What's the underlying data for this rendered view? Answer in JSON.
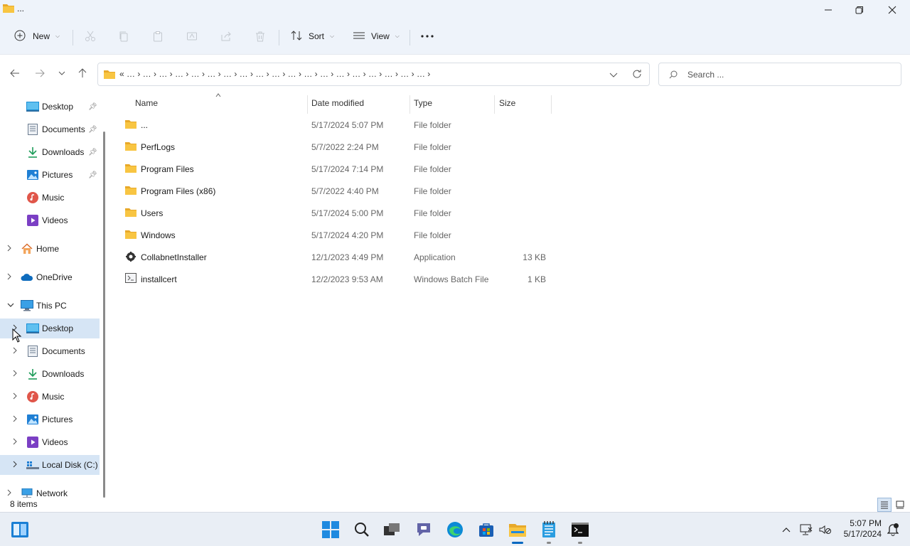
{
  "window": {
    "title": "..."
  },
  "commandbar": {
    "new_label": "New",
    "sort_label": "Sort",
    "view_label": "View",
    "more_label": "···"
  },
  "address": {
    "crumbs": "«  …  ›  …  ›  …  ›  …  ›  …  ›  …  ›  …  ›  …  ›  …  ›  …  ›  …  ›  …  ›  …  ›  …  ›  …  ›  …  ›  …  ›  …  ›  …  ›"
  },
  "search": {
    "placeholder": "Search ..."
  },
  "nav": {
    "quick": [
      {
        "label": "Desktop",
        "icon": "desktop-icon"
      },
      {
        "label": "Documents",
        "icon": "documents-icon"
      },
      {
        "label": "Downloads",
        "icon": "downloads-icon"
      },
      {
        "label": "Pictures",
        "icon": "pictures-icon"
      },
      {
        "label": "Music",
        "icon": "music-icon"
      },
      {
        "label": "Videos",
        "icon": "videos-icon"
      }
    ],
    "home": "Home",
    "onedrive": "OneDrive",
    "thispc": "This PC",
    "pc_items": [
      {
        "label": "Desktop",
        "icon": "desktop-icon"
      },
      {
        "label": "Documents",
        "icon": "documents-icon"
      },
      {
        "label": "Downloads",
        "icon": "downloads-icon"
      },
      {
        "label": "Music",
        "icon": "music-icon"
      },
      {
        "label": "Pictures",
        "icon": "pictures-icon"
      },
      {
        "label": "Videos",
        "icon": "videos-icon"
      },
      {
        "label": "Local Disk (C:)",
        "icon": "drive-icon"
      }
    ],
    "network": "Network"
  },
  "columns": {
    "name": "Name",
    "date": "Date modified",
    "type": "Type",
    "size": "Size"
  },
  "files": [
    {
      "name": "...",
      "date": "5/17/2024 5:07 PM",
      "type": "File folder",
      "size": "",
      "icon": "folder-icon"
    },
    {
      "name": "PerfLogs",
      "date": "5/7/2022 2:24 PM",
      "type": "File folder",
      "size": "",
      "icon": "folder-icon"
    },
    {
      "name": "Program Files",
      "date": "5/17/2024 7:14 PM",
      "type": "File folder",
      "size": "",
      "icon": "folder-icon"
    },
    {
      "name": "Program Files (x86)",
      "date": "5/7/2022 4:40 PM",
      "type": "File folder",
      "size": "",
      "icon": "folder-icon"
    },
    {
      "name": "Users",
      "date": "5/17/2024 5:00 PM",
      "type": "File folder",
      "size": "",
      "icon": "folder-icon"
    },
    {
      "name": "Windows",
      "date": "5/17/2024 4:20 PM",
      "type": "File folder",
      "size": "",
      "icon": "folder-icon"
    },
    {
      "name": "CollabnetInstaller",
      "date": "12/1/2023 4:49 PM",
      "type": "Application",
      "size": "13 KB",
      "icon": "application-icon"
    },
    {
      "name": "installcert",
      "date": "12/2/2023 9:53 AM",
      "type": "Windows Batch File",
      "size": "1 KB",
      "icon": "batch-file-icon"
    }
  ],
  "status": {
    "item_count": "8 items"
  },
  "taskbar": {
    "time": "5:07 PM",
    "date": "5/17/2024"
  },
  "colors": {
    "accent": "#0067c0",
    "folder": "#f8c542",
    "selected_bg": "#d6e5f5",
    "chrome_bg": "#eef3fa"
  }
}
